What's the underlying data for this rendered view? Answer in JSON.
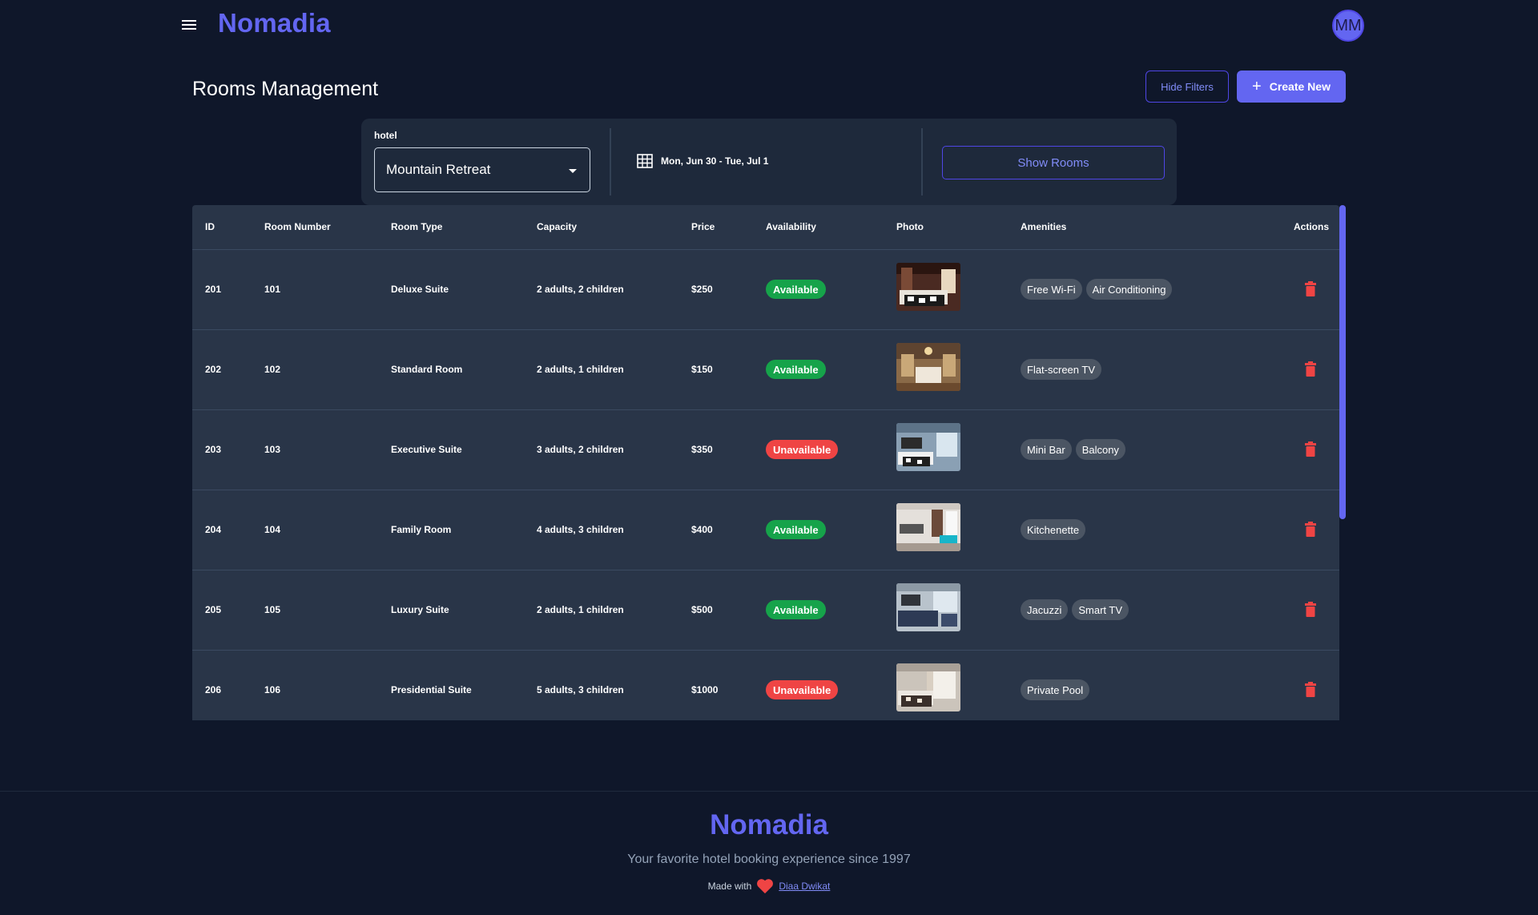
{
  "header": {
    "brand": "Nomadia",
    "avatar_initials": "MM"
  },
  "page": {
    "title": "Rooms Management",
    "hide_filters_label": "Hide Filters",
    "create_new_label": "Create New"
  },
  "filters": {
    "hotel_label": "hotel",
    "hotel_value": "Mountain Retreat",
    "date_range": "Mon, Jun 30 - Tue, Jul 1",
    "show_rooms_label": "Show Rooms"
  },
  "table": {
    "columns": [
      "ID",
      "Room Number",
      "Room Type",
      "Capacity",
      "Price",
      "Availability",
      "Photo",
      "Amenities",
      "Actions"
    ],
    "rows": [
      {
        "id": "201",
        "room_number": "101",
        "room_type": "Deluxe Suite",
        "capacity": "2 adults, 2 children",
        "price": "$250",
        "availability": "Available",
        "amenities": [
          "Free Wi-Fi",
          "Air Conditioning"
        ]
      },
      {
        "id": "202",
        "room_number": "102",
        "room_type": "Standard Room",
        "capacity": "2 adults, 1 children",
        "price": "$150",
        "availability": "Available",
        "amenities": [
          "Flat-screen TV"
        ]
      },
      {
        "id": "203",
        "room_number": "103",
        "room_type": "Executive Suite",
        "capacity": "3 adults, 2 children",
        "price": "$350",
        "availability": "Unavailable",
        "amenities": [
          "Mini Bar",
          "Balcony"
        ]
      },
      {
        "id": "204",
        "room_number": "104",
        "room_type": "Family Room",
        "capacity": "4 adults, 3 children",
        "price": "$400",
        "availability": "Available",
        "amenities": [
          "Kitchenette"
        ]
      },
      {
        "id": "205",
        "room_number": "105",
        "room_type": "Luxury Suite",
        "capacity": "2 adults, 1 children",
        "price": "$500",
        "availability": "Available",
        "amenities": [
          "Jacuzzi",
          "Smart TV"
        ]
      },
      {
        "id": "206",
        "room_number": "106",
        "room_type": "Presidential Suite",
        "capacity": "5 adults, 3 children",
        "price": "$1000",
        "availability": "Unavailable",
        "amenities": [
          "Private Pool"
        ]
      }
    ]
  },
  "footer": {
    "brand": "Nomadia",
    "tagline": "Your favorite hotel booking experience since 1997",
    "made_with": "Made with",
    "author": "Diaa Dwikat"
  },
  "colors": {
    "background": "#0f172a",
    "accent": "#6366f1",
    "available": "#16a34a",
    "unavailable": "#ef4444"
  }
}
